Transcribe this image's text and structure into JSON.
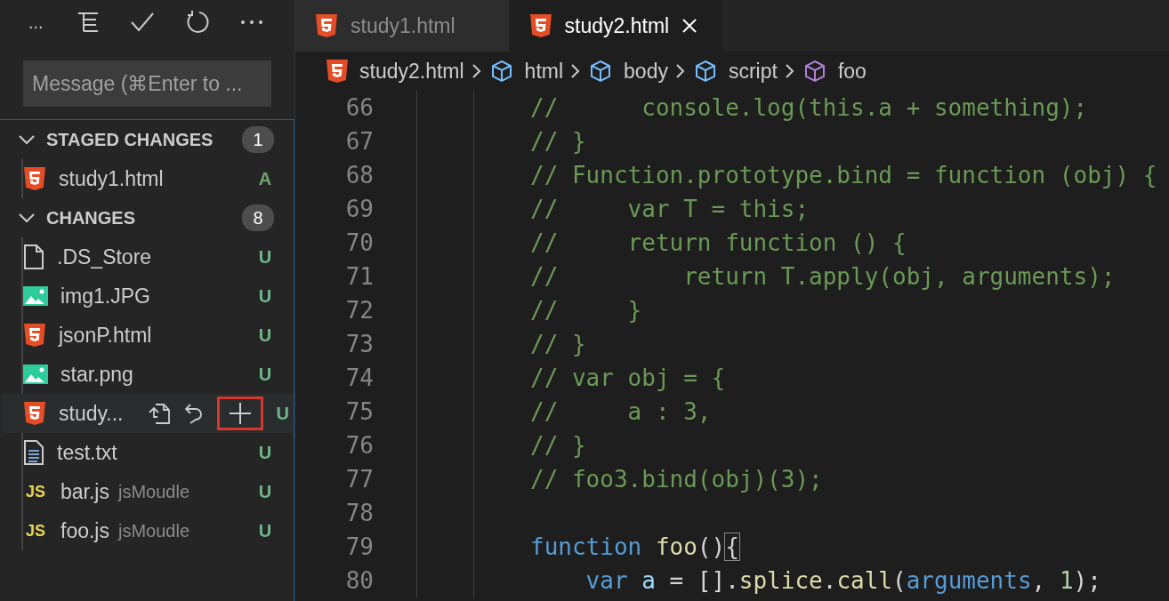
{
  "sidebar": {
    "toolbar": {
      "overflow_text": "..."
    },
    "message": {
      "placeholder": "Message (⌘Enter to ..."
    },
    "sections": [
      {
        "title": "STAGED CHANGES",
        "count": "1",
        "expanded": true,
        "files": [
          {
            "kind": "html",
            "name": "study1.html",
            "status": "A",
            "hovered": false
          }
        ]
      },
      {
        "title": "CHANGES",
        "count": "8",
        "expanded": true,
        "files": [
          {
            "kind": "file",
            "name": ".DS_Store",
            "status": "U",
            "hovered": false
          },
          {
            "kind": "image",
            "name": "img1.JPG",
            "status": "U",
            "hovered": false
          },
          {
            "kind": "html",
            "name": "jsonP.html",
            "status": "U",
            "hovered": false
          },
          {
            "kind": "image",
            "name": "star.png",
            "status": "U",
            "hovered": false
          },
          {
            "kind": "html",
            "name": "study...",
            "status": "U",
            "hovered": true,
            "actions": [
              {
                "kind": "open",
                "highlighted": false
              },
              {
                "kind": "discard",
                "highlighted": false
              },
              {
                "kind": "stage",
                "highlighted": true
              }
            ]
          },
          {
            "kind": "text",
            "name": "test.txt",
            "status": "U",
            "hovered": false
          },
          {
            "kind": "js",
            "icon_text": "JS",
            "name": "bar.js",
            "folder": "jsMoudle",
            "status": "U",
            "hovered": false
          },
          {
            "kind": "js",
            "icon_text": "JS",
            "name": "foo.js",
            "folder": "jsMoudle",
            "status": "U",
            "hovered": false
          }
        ]
      }
    ]
  },
  "tabs": [
    {
      "label": "study1.html",
      "selected": false
    },
    {
      "label": "study2.html",
      "selected": true
    }
  ],
  "breadcrumbs": [
    {
      "kind": "html",
      "label": "study2.html"
    },
    {
      "kind": "element",
      "label": "html"
    },
    {
      "kind": "element",
      "label": "body"
    },
    {
      "kind": "element",
      "label": "script"
    },
    {
      "kind": "function",
      "label": "foo"
    }
  ],
  "code": [
    {
      "number": "66",
      "tokens": [
        {
          "kind": "comment",
          "text": "//      console.log(this.a + something);"
        }
      ]
    },
    {
      "number": "67",
      "tokens": [
        {
          "kind": "comment",
          "text": "// }"
        }
      ]
    },
    {
      "number": "68",
      "tokens": [
        {
          "kind": "comment",
          "text": "// Function.prototype.bind = function (obj) {"
        }
      ]
    },
    {
      "number": "69",
      "tokens": [
        {
          "kind": "comment",
          "text": "//     var T = this;"
        }
      ]
    },
    {
      "number": "70",
      "tokens": [
        {
          "kind": "comment",
          "text": "//     return function () {"
        }
      ]
    },
    {
      "number": "71",
      "tokens": [
        {
          "kind": "comment",
          "text": "//         return T.apply(obj, arguments);"
        }
      ]
    },
    {
      "number": "72",
      "tokens": [
        {
          "kind": "comment",
          "text": "//     }"
        }
      ]
    },
    {
      "number": "73",
      "tokens": [
        {
          "kind": "comment",
          "text": "// }"
        }
      ]
    },
    {
      "number": "74",
      "tokens": [
        {
          "kind": "comment",
          "text": "// var obj = {"
        }
      ]
    },
    {
      "number": "75",
      "tokens": [
        {
          "kind": "comment",
          "text": "//     a : 3,"
        }
      ]
    },
    {
      "number": "76",
      "tokens": [
        {
          "kind": "comment",
          "text": "// }"
        }
      ]
    },
    {
      "number": "77",
      "tokens": [
        {
          "kind": "comment",
          "text": "// foo3.bind(obj)(3);"
        }
      ]
    },
    {
      "number": "78"
    },
    {
      "number": "79",
      "tokens": [
        {
          "kind": "keyword",
          "text": "function"
        },
        {
          "kind": "func",
          "text": " foo"
        },
        {
          "kind": "plain",
          "text": "()"
        },
        {
          "kind": "bracket",
          "text": "{"
        }
      ]
    },
    {
      "number": "80",
      "tokens": [
        {
          "kind": "keyword",
          "text": "    var"
        },
        {
          "kind": "variable",
          "text": " a"
        },
        {
          "kind": "plain",
          "text": " = []."
        },
        {
          "kind": "func",
          "text": "splice"
        },
        {
          "kind": "plain",
          "text": "."
        },
        {
          "kind": "func",
          "text": "call"
        },
        {
          "kind": "plain",
          "text": "("
        },
        {
          "kind": "keyword",
          "text": "arguments"
        },
        {
          "kind": "plain",
          "text": ", "
        },
        {
          "kind": "number",
          "text": "1"
        },
        {
          "kind": "plain",
          "text": ");"
        }
      ]
    }
  ]
}
